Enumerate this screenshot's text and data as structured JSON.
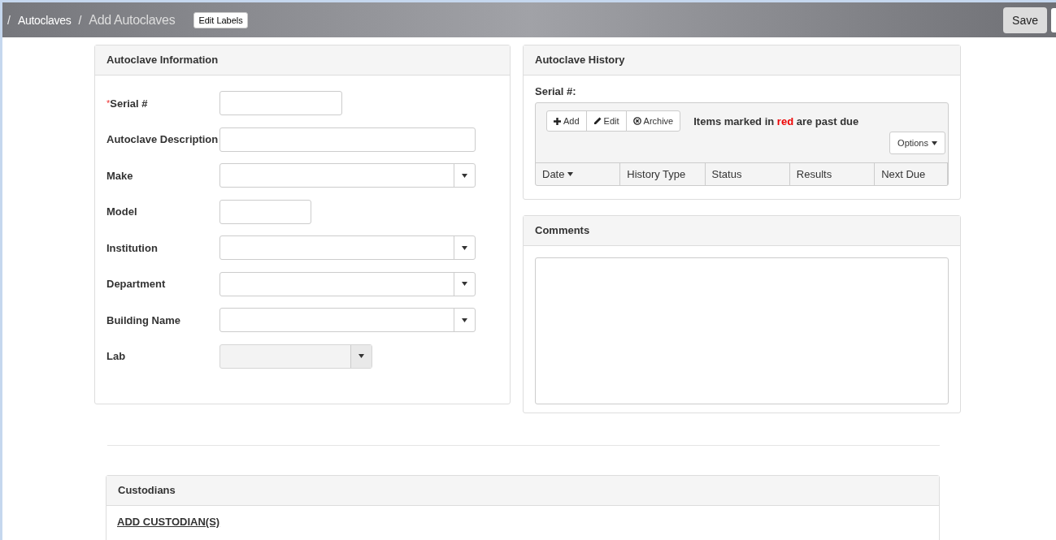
{
  "top_bar": {
    "breadcrumbs": [
      {
        "separator": "/",
        "label": "Autoclaves",
        "current": false
      },
      {
        "separator": "/",
        "label": "Add Autoclaves",
        "current": true
      }
    ],
    "edit_labels_button": "Edit Labels",
    "save_button": "Save"
  },
  "autoclave_information": {
    "title": "Autoclave Information",
    "required_mark": "*",
    "fields": [
      {
        "label": "Serial #",
        "required": true,
        "kind": "medium_input",
        "disabled": false
      },
      {
        "label": "Autoclave Description",
        "required": false,
        "kind": "wide_input",
        "disabled": false
      },
      {
        "label": "Make",
        "required": false,
        "kind": "wide_select",
        "disabled": false
      },
      {
        "label": "Model",
        "required": false,
        "kind": "small_input",
        "disabled": false
      },
      {
        "label": "Institution",
        "required": false,
        "kind": "wide_select",
        "disabled": false
      },
      {
        "label": "Department",
        "required": false,
        "kind": "wide_select",
        "disabled": false
      },
      {
        "label": "Building Name",
        "required": false,
        "kind": "wide_select",
        "disabled": false
      },
      {
        "label": "Lab",
        "required": false,
        "kind": "medium_select",
        "disabled": true
      }
    ]
  },
  "autoclave_history": {
    "title": "Autoclave History",
    "serial_label": "Serial #:",
    "toolbar": [
      {
        "label": "Add",
        "kind": "add"
      },
      {
        "label": "Edit",
        "kind": "edit"
      },
      {
        "label": "Archive",
        "kind": "archive"
      }
    ],
    "notice": "Items marked in **red** are past due",
    "options_button": "Options",
    "columns": [
      {
        "label": "Date",
        "sorted": true
      },
      {
        "label": "History Type",
        "sorted": false
      },
      {
        "label": "Status",
        "sorted": false
      },
      {
        "label": "Results",
        "sorted": false
      },
      {
        "label": "Next Due",
        "sorted": false
      }
    ]
  },
  "comments": {
    "title": "Comments"
  },
  "custodians": {
    "title": "Custodians",
    "add_link": "ADD CUSTODIAN(S)"
  }
}
